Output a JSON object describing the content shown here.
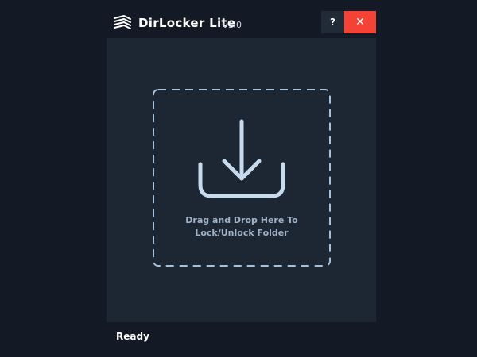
{
  "window": {
    "title": "DirLocker Lite",
    "version": "v1.0",
    "help_label": "?",
    "close_label": "✕"
  },
  "dropzone": {
    "line1": "Drag and Drop Here To",
    "line2": "Lock/Unlock Folder",
    "icon": "download-icon"
  },
  "status": {
    "text": "Ready"
  },
  "colors": {
    "background": "#131a26",
    "panel": "#1d2633",
    "accent_close": "#f44336",
    "dropzone_line": "#a9c1d8"
  }
}
